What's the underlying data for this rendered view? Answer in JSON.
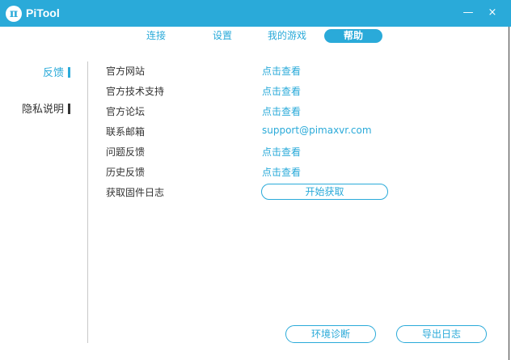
{
  "window": {
    "logo_glyph": "π",
    "title": "PiTool",
    "minimize_glyph": "—",
    "close_glyph": "×"
  },
  "tabs": [
    {
      "label": "连接",
      "active": false
    },
    {
      "label": "设置",
      "active": false
    },
    {
      "label": "我的游戏",
      "active": false
    },
    {
      "label": "帮助",
      "active": true
    }
  ],
  "sidebar": {
    "items": [
      {
        "label": "反馈",
        "active": true
      },
      {
        "label": "隐私说明",
        "active": false
      }
    ]
  },
  "feedback": {
    "rows": [
      {
        "label": "官方网站",
        "value": "点击查看"
      },
      {
        "label": "官方技术支持",
        "value": "点击查看"
      },
      {
        "label": "官方论坛",
        "value": "点击查看"
      },
      {
        "label": "联系邮箱",
        "value": "support@pimaxvr.com"
      },
      {
        "label": "问题反馈",
        "value": "点击查看"
      },
      {
        "label": "历史反馈",
        "value": "点击查看"
      },
      {
        "label": "获取固件日志",
        "button": "开始获取"
      }
    ]
  },
  "footer": {
    "diagnose_label": "环境诊断",
    "export_log_label": "导出日志"
  },
  "colors": {
    "accent": "#2aaad9",
    "text": "#333333",
    "background": "#ffffff"
  }
}
